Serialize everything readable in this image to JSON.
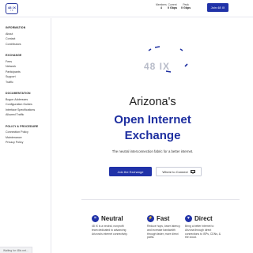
{
  "header": {
    "logo_top": "48 IX",
    "logo_bottom": "I X",
    "stats": [
      {
        "label": "Members",
        "value": "4"
      },
      {
        "label": "Current",
        "value": "0 Gbps"
      },
      {
        "label": "Peak",
        "value": "0 Gbps"
      }
    ],
    "join_label": "Join 48 IX"
  },
  "sidebar": {
    "sections": [
      {
        "title": "INFORMATION",
        "items": [
          "About",
          "Contact",
          "Contributors"
        ]
      },
      {
        "title": "EXCHANGE",
        "items": [
          "Fees",
          "Network",
          "Participants",
          "Support",
          "Traffic"
        ]
      },
      {
        "title": "DOCUMENTATION",
        "items": [
          "Bogon Addresses",
          "Configuration Guides",
          "Interface Specifications",
          "Allowed Traffic"
        ]
      },
      {
        "title": "POLICY & PROCEDURE",
        "items": [
          "Connection Policy",
          "Maintenance",
          "Privacy Policy"
        ]
      }
    ]
  },
  "hero": {
    "graphic_text": "48  IX",
    "title_line1": "Arizona's",
    "title_line2": "Open Internet",
    "title_line3": "Exchange",
    "tagline": "The neutral interconnection fabric for a better internet.",
    "primary_button": "Join the Exchange",
    "secondary_button": "Where to Connect"
  },
  "features": [
    {
      "icon": "equals-icon",
      "glyph": "=",
      "title": "Neutral",
      "desc": "48 IX is a neutral, nonprofit team dedicated to advancing Arizona's internet connectivity."
    },
    {
      "icon": "bolt-icon",
      "glyph": "⚡",
      "title": "Fast",
      "desc": "Reduce hops, lower latency, and increase bandwidth through faster, more direct paths."
    },
    {
      "icon": "heart-icon",
      "glyph": "♥",
      "title": "Direct",
      "desc": "Bring a better internet to Arizona through direct connections to ISPs, CDNs, & the cloud."
    }
  ],
  "statusbar": "Waiting for 48ix.net...",
  "colors": {
    "accent": "#2032a8",
    "heading_blue": "#1e2fa0",
    "logo": "#2b3a9e"
  }
}
